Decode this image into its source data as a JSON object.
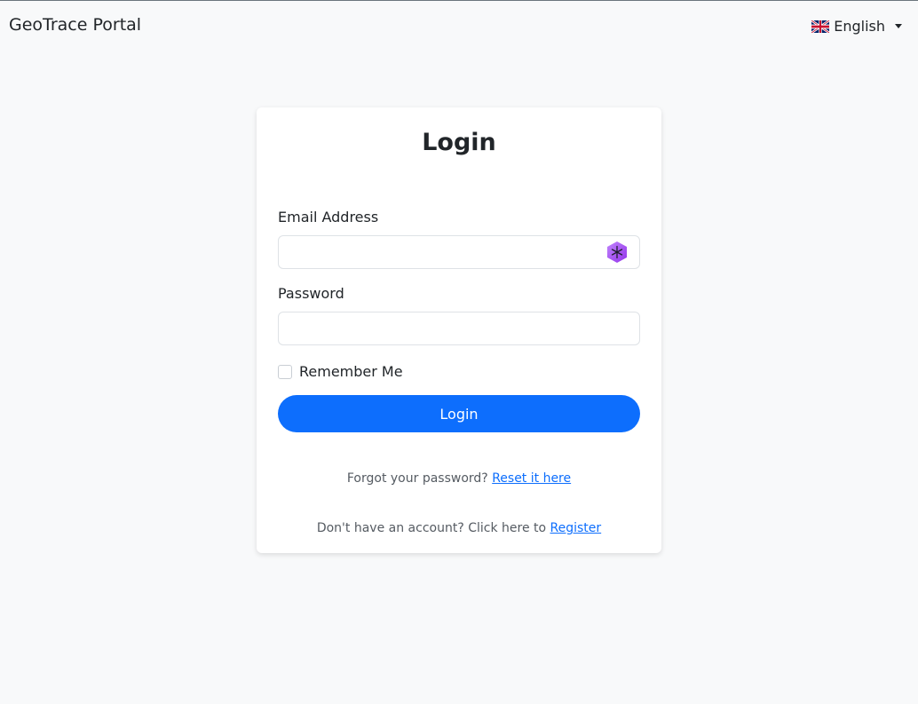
{
  "header": {
    "brand": "GeoTrace Portal",
    "language": "English",
    "language_flag_icon": "uk-flag-icon",
    "dropdown_icon": "caret-down-icon"
  },
  "login": {
    "title": "Login",
    "email_label": "Email Address",
    "email_value": "",
    "email_extension_icon": "password-manager-icon",
    "password_label": "Password",
    "password_value": "",
    "remember_label": "Remember Me",
    "remember_checked": false,
    "submit_label": "Login",
    "forgot_text": "Forgot your password?",
    "forgot_link": "Reset it here",
    "register_text": "Don't have an account? Click here to",
    "register_link": "Register"
  },
  "colors": {
    "primary": "#0d6efd",
    "background": "#f8f9fa",
    "card": "#ffffff",
    "extension_icon": "#a855f7"
  }
}
